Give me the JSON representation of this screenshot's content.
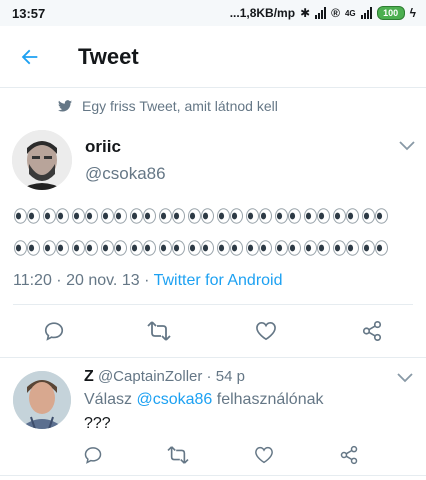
{
  "status_bar": {
    "time": "13:57",
    "network": "...1,8KB/mp",
    "battery": "100",
    "network_type": "4G"
  },
  "header": {
    "title": "Tweet"
  },
  "context": {
    "text": "Egy friss Tweet, amit látnod kell"
  },
  "tweet": {
    "name": "oriic",
    "handle": "@csoka86",
    "eyes_per_row": 13,
    "time": "11:20",
    "date": "20 nov. 13",
    "separator": " · ",
    "source": "Twitter for Android"
  },
  "reply": {
    "name": "Z",
    "handle": "@CaptainZoller",
    "sep": " · ",
    "age": "54 p",
    "reply_prefix": "Válasz ",
    "reply_mention": "@csoka86",
    "reply_suffix": " felhasználónak",
    "text": "???"
  },
  "colors": {
    "accent": "#1da1f2",
    "secondary_text": "#657786",
    "divider": "#e6ecf0"
  }
}
